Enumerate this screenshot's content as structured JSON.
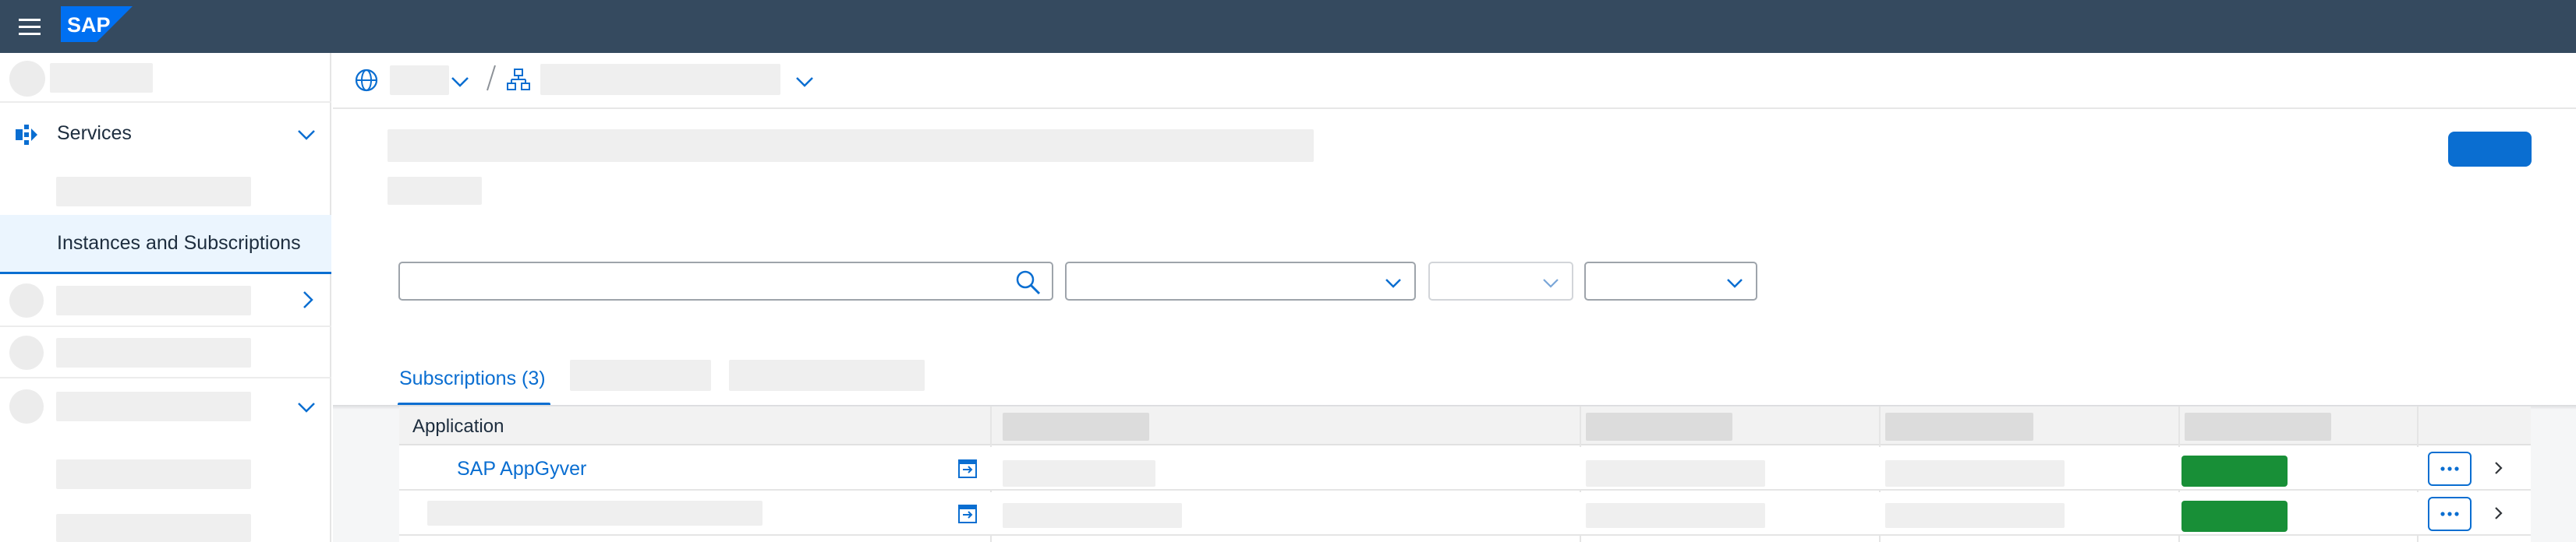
{
  "shell": {
    "menu_icon": "hamburger-icon",
    "logo_text": "SAP",
    "brand_color": "#0070f2",
    "bar_color": "#354a5f"
  },
  "sidebar": {
    "services_label": "Services",
    "services_icon": "services-icon",
    "selected_item_label": "Instances and Subscriptions"
  },
  "filters": {
    "search_value": "",
    "search_placeholder": "",
    "search_icon": "search-icon"
  },
  "tabs": {
    "subscriptions_label": "Subscriptions (3)"
  },
  "table": {
    "header_application": "Application",
    "rows": [
      {
        "application": "SAP AppGyver",
        "status_color": "#188f37"
      },
      {
        "application": "",
        "status_color": "#188f37"
      }
    ]
  },
  "colors": {
    "accent": "#0a6ed1",
    "status_green": "#188f37"
  }
}
